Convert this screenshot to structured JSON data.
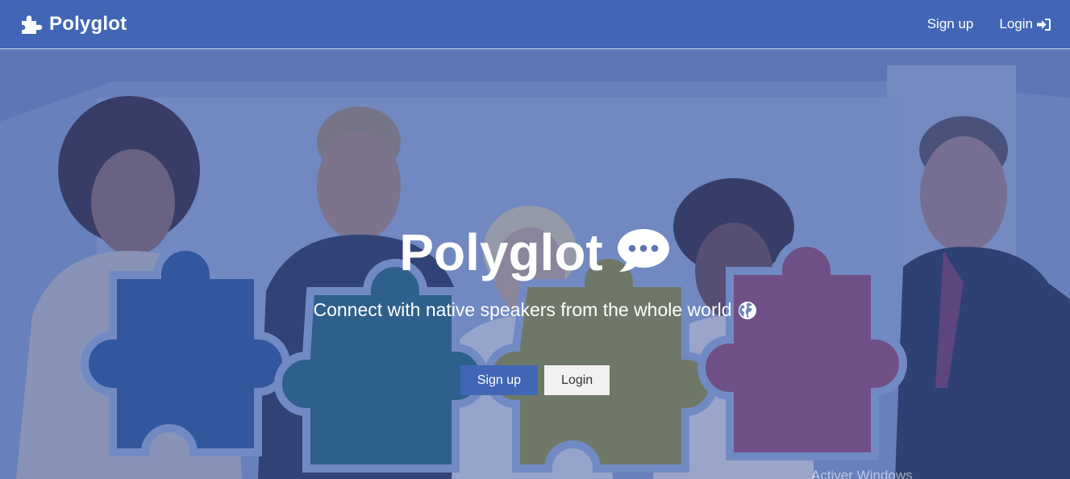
{
  "navbar": {
    "brand": "Polyglot",
    "brand_icon": "puzzle-icon",
    "signup_label": "Sign up",
    "login_label": "Login",
    "login_icon": "sign-in-icon",
    "background": "#4066b5"
  },
  "hero": {
    "title": "Polyglot",
    "title_icon": "comment-dots-icon",
    "subtitle": "Connect with native speakers from the whole world",
    "subtitle_icon": "globe-icon",
    "signup_button": "Sign up",
    "login_button": "Login",
    "primary_color": "#4066b5"
  },
  "watermark": "Activer Windows"
}
